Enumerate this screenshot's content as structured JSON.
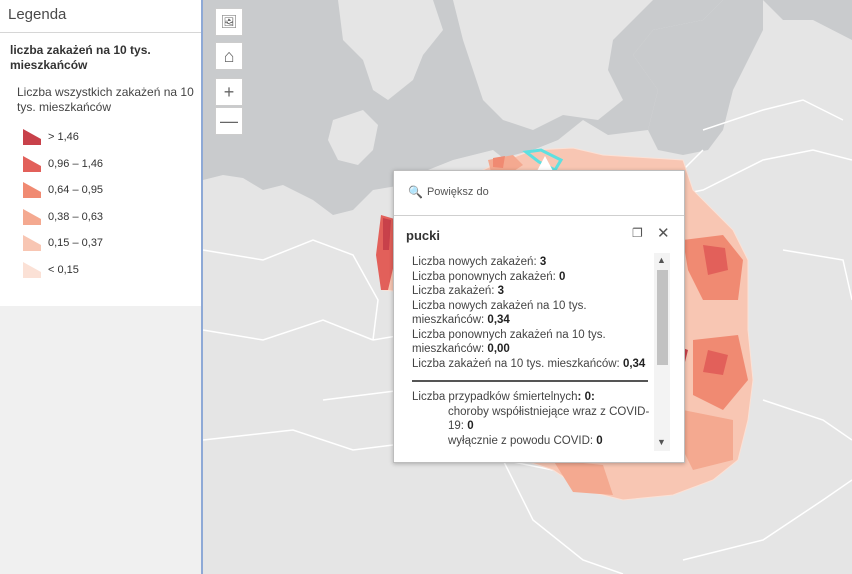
{
  "legend": {
    "title": "Legenda",
    "layer_title": "liczba zakażeń na 10 tys. mieszkańców",
    "field_title": "Liczba wszystkich zakażeń na 10 tys. mieszkańców",
    "items": [
      {
        "label": "> 1,46",
        "color": "#c8414a"
      },
      {
        "label": "0,96 – 1,46",
        "color": "#e2605a"
      },
      {
        "label": "0,64 – 0,95",
        "color": "#f08a72"
      },
      {
        "label": "0,38 – 0,63",
        "color": "#f4a990"
      },
      {
        "label": "0,15 – 0,37",
        "color": "#f8c6b3"
      },
      {
        "label": "< 0,15",
        "color": "#fbe1d6"
      }
    ]
  },
  "map": {
    "buttons": [
      {
        "name": "basemap-gallery-button",
        "icon": "image-icon",
        "glyph": "🖼"
      },
      {
        "name": "home-button",
        "icon": "home-icon",
        "glyph": "⌂"
      },
      {
        "name": "zoom-in-button",
        "icon": "plus-icon",
        "glyph": "+"
      },
      {
        "name": "zoom-out-button",
        "icon": "minus-icon",
        "glyph": "—"
      }
    ],
    "colors": {
      "land": "#e5e5e5",
      "water": "#c9cbcd",
      "border": "#ffffff",
      "selected": "#5fe0e0"
    }
  },
  "popup": {
    "zoom_label": "Powiększ do",
    "title": "pucki",
    "lines": [
      {
        "label": "Liczba nowych zakażeń: ",
        "value": "3"
      },
      {
        "label": "Liczba ponownych zakażeń: ",
        "value": "0"
      },
      {
        "label": "Liczba zakażeń: ",
        "value": "3"
      },
      {
        "label": "Liczba nowych zakażeń na 10 tys. mieszkańców: ",
        "value": "0,34"
      },
      {
        "label": "Liczba ponownych zakażeń na 10 tys. mieszkańców: ",
        "value": "0,00"
      },
      {
        "label": "Liczba zakażeń na 10 tys. mieszkańców: ",
        "value": "0,34"
      }
    ],
    "deaths_label": "Liczba przypadków śmiertelnych",
    "deaths_value": ": 0:",
    "deaths_sub": [
      {
        "label": "choroby współistniejące wraz z COVID-19: ",
        "value": "0"
      },
      {
        "label": "wyłącznie z powodu COVID: ",
        "value": "0"
      }
    ]
  }
}
